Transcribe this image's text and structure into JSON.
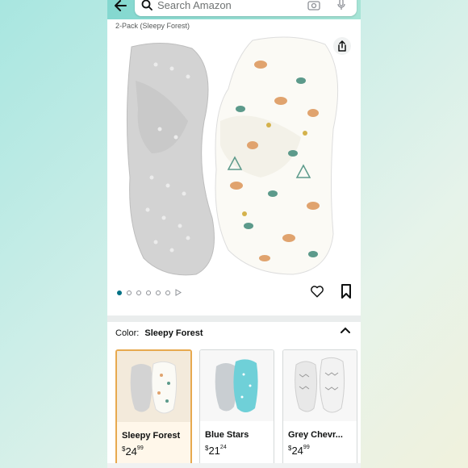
{
  "search": {
    "placeholder": "Search Amazon"
  },
  "product": {
    "breadcrumb": "2-Pack (Sleepy Forest)",
    "image_count": 6,
    "active_image": 1
  },
  "variation": {
    "label": "Color:",
    "selected": "Sleepy Forest"
  },
  "tiles": [
    {
      "name": "Sleepy Forest",
      "currency": "$",
      "whole": "24",
      "fraction": "99",
      "selected": true
    },
    {
      "name": "Blue Stars",
      "currency": "$",
      "whole": "21",
      "fraction": "24",
      "selected": false
    },
    {
      "name": "Grey Chevr...",
      "currency": "$",
      "whole": "24",
      "fraction": "99",
      "selected": false
    }
  ],
  "colors": {
    "header": "#84d8d0",
    "accent": "#007185",
    "selected_border": "#e7a94f"
  }
}
